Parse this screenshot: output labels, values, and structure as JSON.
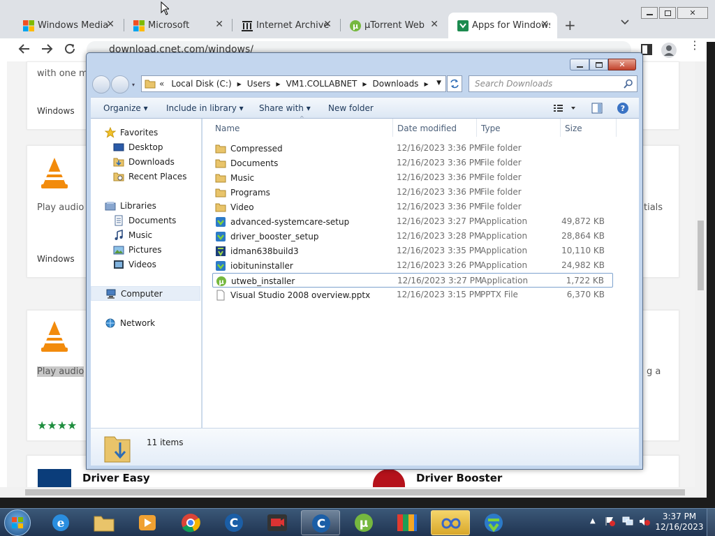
{
  "browser": {
    "tabs": [
      {
        "label": "Windows Media",
        "icon": "windows-logo-icon"
      },
      {
        "label": "Microsoft",
        "icon": "microsoft-logo-icon"
      },
      {
        "label": "Internet Archive",
        "icon": "archive-icon"
      },
      {
        "label": "µTorrent Web",
        "icon": "utorrent-icon"
      },
      {
        "label": "Apps for Windows",
        "icon": "cnet-download-icon"
      }
    ],
    "url": "download.cnet.com/windows/"
  },
  "page": {
    "top_text": "with one m",
    "platform_1": "Windows",
    "vlc_line_1": "Play audio",
    "right_text_1": "tials",
    "platform_2": "Windows",
    "vlc_line_2": "Play audio",
    "right_text_2": "g a",
    "bottom_left": "Driver Easy",
    "bottom_right": "Driver Booster"
  },
  "explorer": {
    "breadcrumb": [
      "Local Disk (C:)",
      "Users",
      "VM1.COLLABNET",
      "Downloads"
    ],
    "search_placeholder": "Search Downloads",
    "commands": {
      "organize": "Organize",
      "include": "Include in library",
      "share": "Share with",
      "new_folder": "New folder"
    },
    "nav": {
      "favorites": "Favorites",
      "desktop": "Desktop",
      "downloads": "Downloads",
      "recent": "Recent Places",
      "libraries": "Libraries",
      "documents": "Documents",
      "music": "Music",
      "pictures": "Pictures",
      "videos": "Videos",
      "computer": "Computer",
      "network": "Network"
    },
    "columns": {
      "name": "Name",
      "date": "Date modified",
      "type": "Type",
      "size": "Size"
    },
    "files": [
      {
        "name": "Compressed",
        "date": "12/16/2023 3:36 PM",
        "type": "File folder",
        "size": "",
        "icon": "folder"
      },
      {
        "name": "Documents",
        "date": "12/16/2023 3:36 PM",
        "type": "File folder",
        "size": "",
        "icon": "folder"
      },
      {
        "name": "Music",
        "date": "12/16/2023 3:36 PM",
        "type": "File folder",
        "size": "",
        "icon": "folder"
      },
      {
        "name": "Programs",
        "date": "12/16/2023 3:36 PM",
        "type": "File folder",
        "size": "",
        "icon": "folder"
      },
      {
        "name": "Video",
        "date": "12/16/2023 3:36 PM",
        "type": "File folder",
        "size": "",
        "icon": "folder"
      },
      {
        "name": "advanced-systemcare-setup",
        "date": "12/16/2023 3:27 PM",
        "type": "Application",
        "size": "49,872 KB",
        "icon": "installer"
      },
      {
        "name": "driver_booster_setup",
        "date": "12/16/2023 3:28 PM",
        "type": "Application",
        "size": "28,864 KB",
        "icon": "installer"
      },
      {
        "name": "idman638build3",
        "date": "12/16/2023 3:35 PM",
        "type": "Application",
        "size": "10,110 KB",
        "icon": "idm"
      },
      {
        "name": "iobituninstaller",
        "date": "12/16/2023 3:26 PM",
        "type": "Application",
        "size": "24,982 KB",
        "icon": "installer"
      },
      {
        "name": "utweb_installer",
        "date": "12/16/2023 3:27 PM",
        "type": "Application",
        "size": "1,722 KB",
        "icon": "utorrent"
      },
      {
        "name": "Visual Studio 2008 overview.pptx",
        "date": "12/16/2023 3:15 PM",
        "type": "PPTX File",
        "size": "6,370 KB",
        "icon": "document"
      }
    ],
    "status": "11 items"
  },
  "taskbar": {
    "time": "3:37 PM",
    "date": "12/16/2023"
  }
}
